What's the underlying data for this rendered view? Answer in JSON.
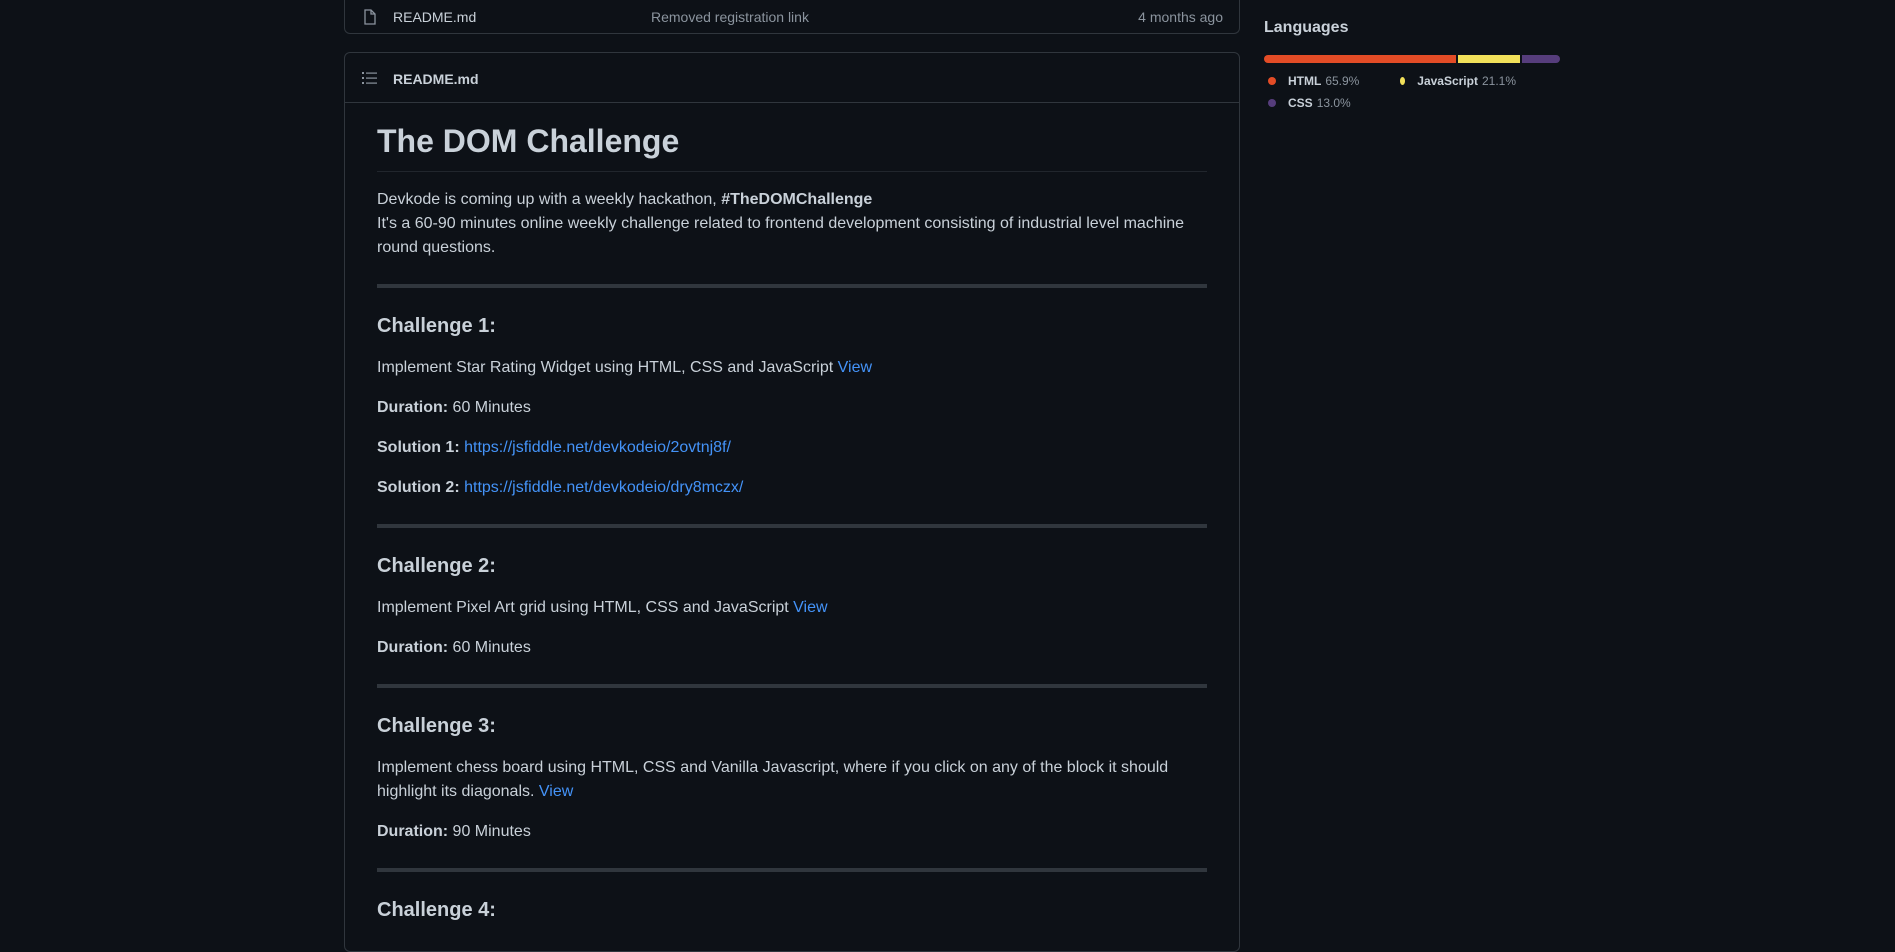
{
  "file_row": {
    "name": "README.md",
    "commit_message": "Removed registration link",
    "age": "4 months ago"
  },
  "readme": {
    "header_title": "README.md",
    "title": "The DOM Challenge",
    "intro_text": "Devkode is coming up with a weekly hackathon, ",
    "intro_bold": "#TheDOMChallenge",
    "intro_line2": "It's a 60-90 minutes online weekly challenge related to frontend development consisting of industrial level machine round questions.",
    "challenges": [
      {
        "heading": "Challenge 1:",
        "description": "Implement Star Rating Widget using HTML, CSS and JavaScript ",
        "view_link": "View",
        "duration_label": "Duration:",
        "duration_value": " 60 Minutes",
        "solutions": [
          {
            "label": "Solution 1:",
            "url": "https://jsfiddle.net/devkodeio/2ovtnj8f/"
          },
          {
            "label": "Solution 2:",
            "url": "https://jsfiddle.net/devkodeio/dry8mczx/"
          }
        ]
      },
      {
        "heading": "Challenge 2:",
        "description": "Implement Pixel Art grid using HTML, CSS and JavaScript ",
        "view_link": "View",
        "duration_label": "Duration:",
        "duration_value": " 60 Minutes"
      },
      {
        "heading": "Challenge 3:",
        "description": "Implement chess board using HTML, CSS and Vanilla Javascript, where if you click on any of the block it should highlight its diagonals. ",
        "view_link": "View",
        "duration_label": "Duration:",
        "duration_value": " 90 Minutes"
      },
      {
        "heading": "Challenge 4:"
      }
    ]
  },
  "languages": {
    "title": "Languages",
    "items": [
      {
        "name": "HTML",
        "percent": "65.9%",
        "value": 65.9,
        "color": "#e34c26"
      },
      {
        "name": "JavaScript",
        "percent": "21.1%",
        "value": 21.1,
        "color": "#f1e05a"
      },
      {
        "name": "CSS",
        "percent": "13.0%",
        "value": 13.0,
        "color": "#563d7c"
      }
    ]
  },
  "icons": {
    "file": "file-icon",
    "toc": "list-unordered-icon"
  }
}
